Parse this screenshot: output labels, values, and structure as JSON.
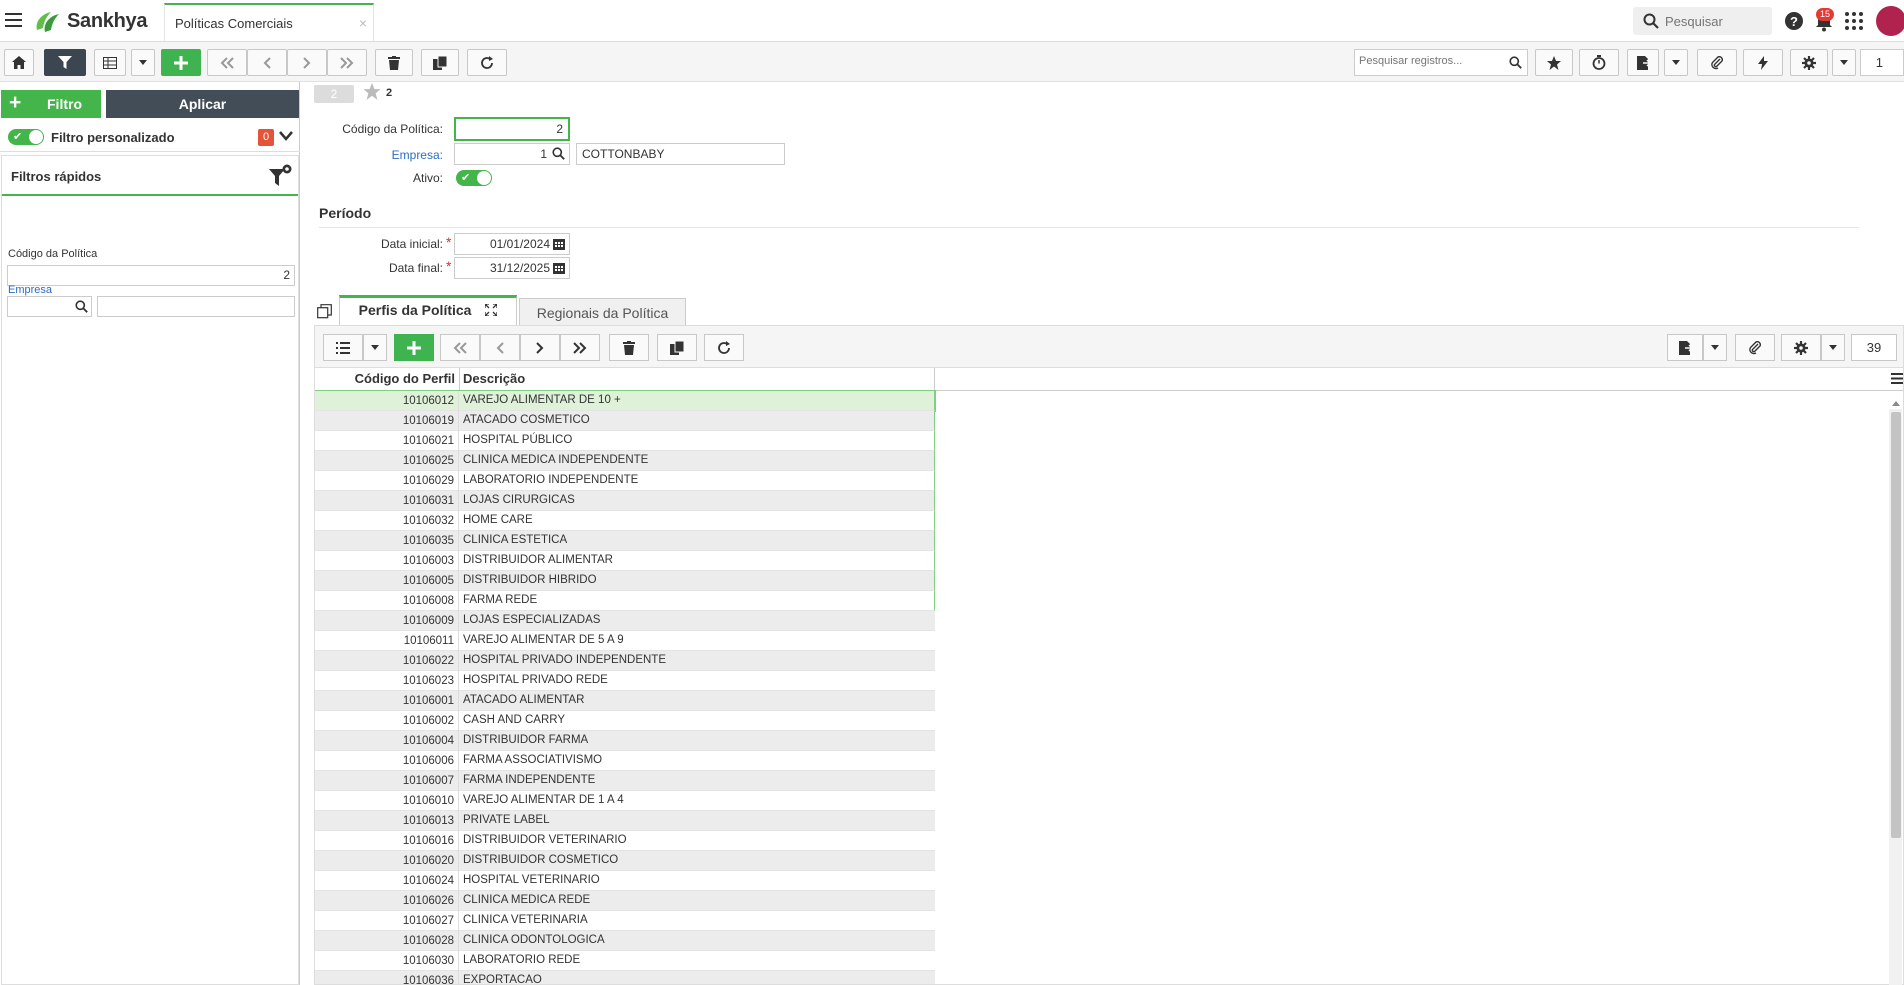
{
  "topbar": {
    "brand": "Sankhya",
    "tab_title": "Políticas Comerciais",
    "tab_close": "×",
    "search_placeholder": "Pesquisar",
    "notification_count": "15"
  },
  "toolbar": {
    "search_placeholder": "Pesquisar registros...",
    "page_number": "1"
  },
  "filters": {
    "filter_button": "Filtro",
    "apply_button": "Aplicar",
    "custom_filter_label": "Filtro personalizado",
    "custom_filter_count": "0",
    "quick_filters_title": "Filtros rápidos",
    "codigo_label": "Código da Política",
    "codigo_value": "2",
    "empresa_label": "Empresa",
    "empresa_code": "",
    "empresa_name": ""
  },
  "record": {
    "badge": "2",
    "star_count": "2"
  },
  "form": {
    "codigo_label": "Código da Política:",
    "codigo_value": "2",
    "empresa_label": "Empresa:",
    "empresa_code": "1",
    "empresa_name": "COTTONBABY",
    "ativo_label": "Ativo:",
    "periodo_title": "Período",
    "data_inicial_label": "Data inicial:",
    "data_inicial_value": "01/01/2024",
    "data_final_label": "Data final:",
    "data_final_value": "31/12/2025",
    "required_mark": "*"
  },
  "detail_tabs": [
    {
      "label": "Perfis da Política"
    },
    {
      "label": "Regionais da Política"
    }
  ],
  "grid": {
    "page_size": "39",
    "columns": [
      "Código do Perfil",
      "Descrição"
    ],
    "rows": [
      {
        "code": "10106012",
        "desc": "VAREJO ALIMENTAR DE 10 +"
      },
      {
        "code": "10106019",
        "desc": "ATACADO COSMETICO"
      },
      {
        "code": "10106021",
        "desc": "HOSPITAL PÚBLICO"
      },
      {
        "code": "10106025",
        "desc": "CLINICA MEDICA INDEPENDENTE"
      },
      {
        "code": "10106029",
        "desc": "LABORATORIO INDEPENDENTE"
      },
      {
        "code": "10106031",
        "desc": "LOJAS CIRURGICAS"
      },
      {
        "code": "10106032",
        "desc": "HOME CARE"
      },
      {
        "code": "10106035",
        "desc": "CLINICA ESTETICA"
      },
      {
        "code": "10106003",
        "desc": "DISTRIBUIDOR ALIMENTAR"
      },
      {
        "code": "10106005",
        "desc": "DISTRIBUIDOR HIBRIDO"
      },
      {
        "code": "10106008",
        "desc": "FARMA REDE"
      },
      {
        "code": "10106009",
        "desc": "LOJAS ESPECIALIZADAS"
      },
      {
        "code": "10106011",
        "desc": "VAREJO ALIMENTAR DE 5 A 9"
      },
      {
        "code": "10106022",
        "desc": "HOSPITAL PRIVADO INDEPENDENTE"
      },
      {
        "code": "10106023",
        "desc": "HOSPITAL PRIVADO REDE"
      },
      {
        "code": "10106001",
        "desc": "ATACADO ALIMENTAR"
      },
      {
        "code": "10106002",
        "desc": "CASH AND CARRY"
      },
      {
        "code": "10106004",
        "desc": "DISTRIBUIDOR FARMA"
      },
      {
        "code": "10106006",
        "desc": "FARMA ASSOCIATIVISMO"
      },
      {
        "code": "10106007",
        "desc": "FARMA INDEPENDENTE"
      },
      {
        "code": "10106010",
        "desc": "VAREJO ALIMENTAR DE 1 A 4"
      },
      {
        "code": "10106013",
        "desc": "PRIVATE LABEL"
      },
      {
        "code": "10106016",
        "desc": "DISTRIBUIDOR VETERINARIO"
      },
      {
        "code": "10106020",
        "desc": "DISTRIBUIDOR COSMETICO"
      },
      {
        "code": "10106024",
        "desc": "HOSPITAL VETERINARIO"
      },
      {
        "code": "10106026",
        "desc": "CLINICA MEDICA REDE"
      },
      {
        "code": "10106027",
        "desc": "CLINICA VETERINARIA"
      },
      {
        "code": "10106028",
        "desc": "CLINICA ODONTOLOGICA"
      },
      {
        "code": "10106030",
        "desc": "LABORATORIO REDE"
      },
      {
        "code": "10106036",
        "desc": "EXPORTACAO"
      }
    ]
  },
  "colors": {
    "accent_green": "#43b54a",
    "dark_button": "#434d57",
    "link_blue": "#2b6cc4",
    "badge_red": "#e55437"
  }
}
